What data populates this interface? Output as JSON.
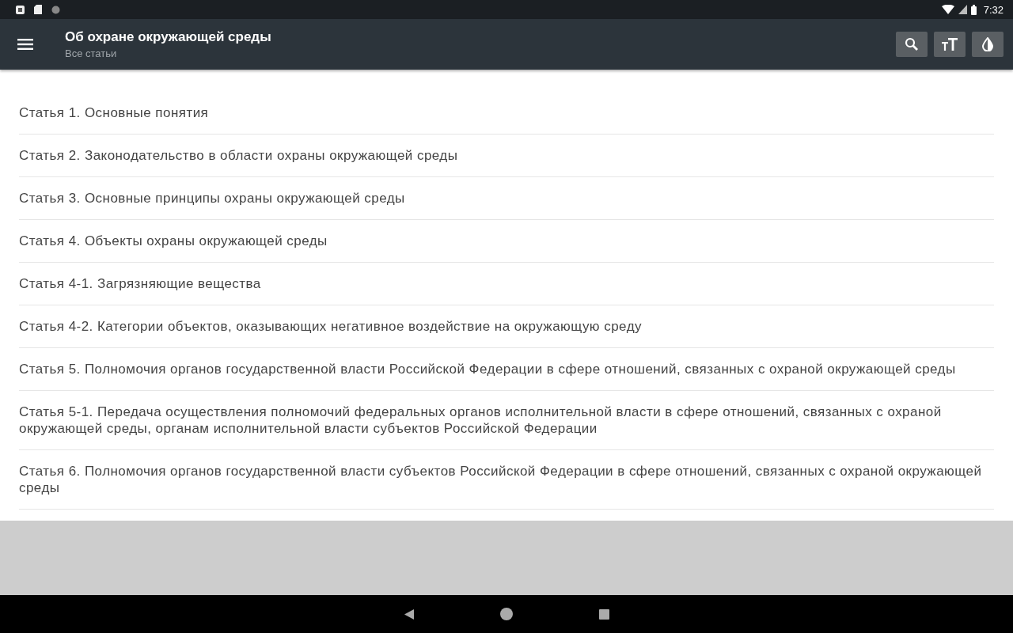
{
  "status_bar": {
    "time": "7:32"
  },
  "app_bar": {
    "title": "Об охране окружающей среды",
    "subtitle": "Все статьи"
  },
  "articles": [
    {
      "title": "Статья 1. Основные понятия"
    },
    {
      "title": "Статья 2. Законодательство в области охраны окружающей среды"
    },
    {
      "title": "Статья 3. Основные принципы охраны окружающей среды"
    },
    {
      "title": "Статья 4. Объекты охраны окружающей среды"
    },
    {
      "title": "Статья 4-1. Загрязняющие вещества"
    },
    {
      "title": "Статья 4-2. Категории объектов, оказывающих негативное воздействие на окружающую среду"
    },
    {
      "title": "Статья 5. Полномочия органов государственной власти Российской Федерации в сфере отношений, связанных с охраной окружающей среды"
    },
    {
      "title": "Статья 5-1. Передача осуществления полномочий федеральных органов исполнительной власти в сфере отношений, связанных с охраной окружающей среды, органам исполнительной власти субъектов Российской Федерации"
    },
    {
      "title": "Статья 6. Полномочия органов государственной власти субъектов Российской Федерации в сфере отношений, связанных с охраной окружающей среды"
    }
  ]
}
